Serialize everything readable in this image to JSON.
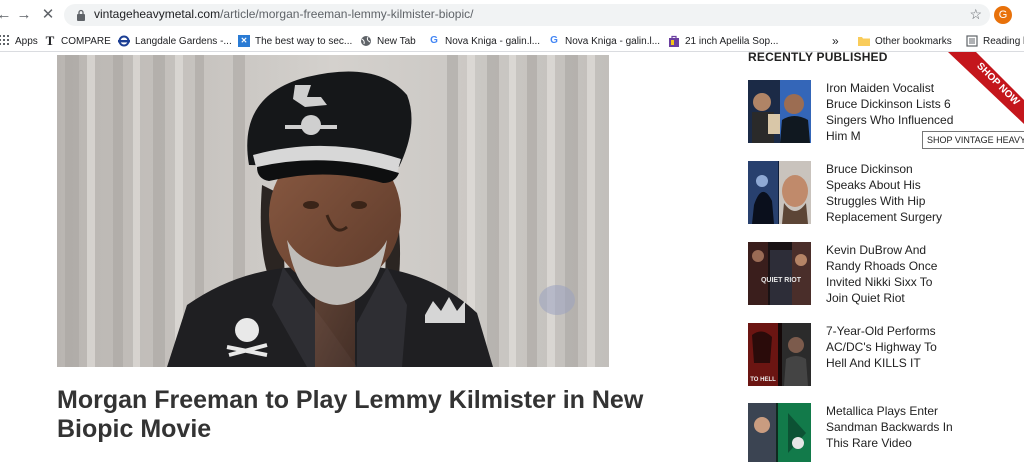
{
  "browser": {
    "url_host": "vintageheavymetal.com",
    "url_path": "/article/morgan-freeman-lemmy-kilmister-biopic/",
    "profile_initial": "G"
  },
  "bookmarks": [
    {
      "label": "Apps"
    },
    {
      "label": "COMPARE"
    },
    {
      "label": "Langdale Gardens -..."
    },
    {
      "label": "The best way to sec..."
    },
    {
      "label": "New Tab"
    },
    {
      "label": "Nova Kniga - galin.l..."
    },
    {
      "label": "Nova Kniga - galin.l..."
    },
    {
      "label": "21 inch Apelila Sop..."
    },
    {
      "label": "»"
    },
    {
      "label": "Other bookmarks"
    },
    {
      "label": "Reading l"
    }
  ],
  "article": {
    "title": "Morgan Freeman to Play Lemmy Kilmister in New Biopic Movie"
  },
  "sidebar": {
    "heading": "RECENTLY PUBLISHED",
    "ribbon": "SHOP NOW",
    "tooltip": "SHOP VINTAGE HEAVY",
    "items": [
      {
        "title": "Iron Maiden Vocalist Bruce Dickinson Lists 6 Singers Who Influenced Him M"
      },
      {
        "title": "Bruce Dickinson Speaks About His Struggles With Hip Replacement Surgery"
      },
      {
        "title": "Kevin DuBrow And Randy Rhoads Once Invited Nikki Sixx To Join Quiet Riot"
      },
      {
        "title": "7-Year-Old Performs AC/DC's Highway To Hell And KILLS IT"
      },
      {
        "title": "Metallica Plays Enter Sandman Backwards In This Rare Video"
      }
    ],
    "thumb_labels": [
      "QUIET RIOT",
      "TO HELL"
    ]
  }
}
